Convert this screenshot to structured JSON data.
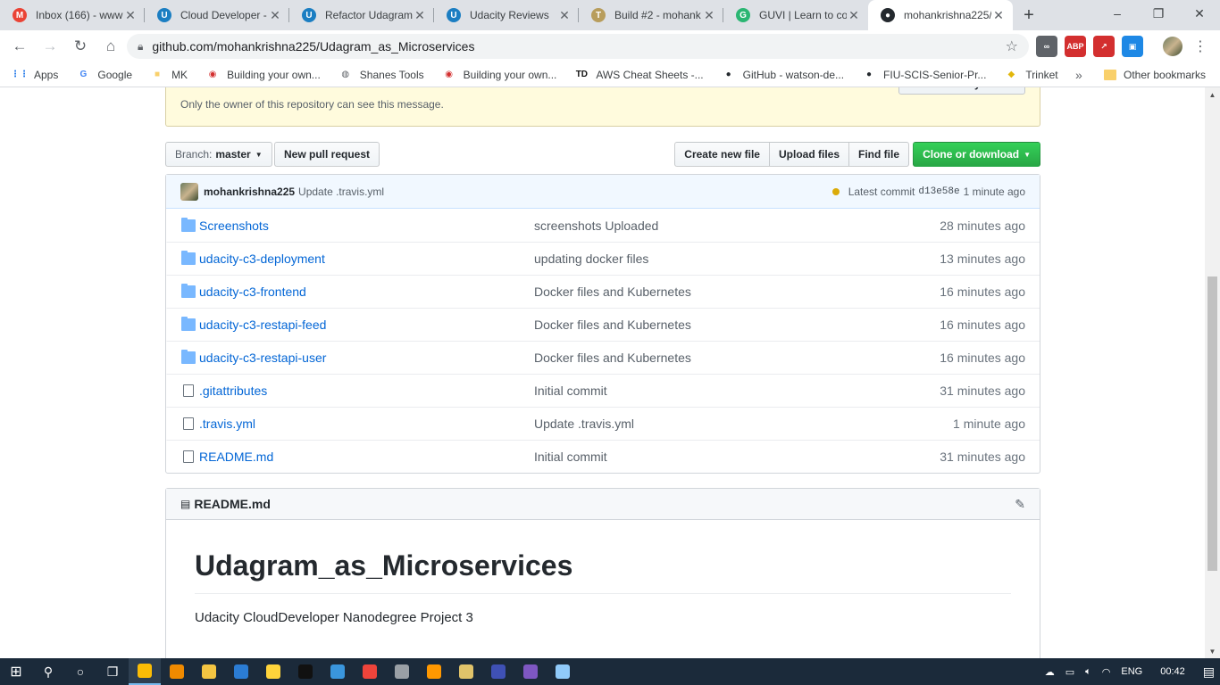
{
  "browser": {
    "tabs": [
      {
        "title": "Inbox (166) - www",
        "icon_color": "#ea4335",
        "icon": "gmail-icon",
        "glyph": "M"
      },
      {
        "title": "Cloud Developer -",
        "icon_color": "#1b7ec2",
        "icon": "udacity-icon",
        "glyph": "U"
      },
      {
        "title": "Refactor Udagram",
        "icon_color": "#1b7ec2",
        "icon": "udacity-icon",
        "glyph": "U"
      },
      {
        "title": "Udacity Reviews",
        "icon_color": "#1b7ec2",
        "icon": "udacity-icon",
        "glyph": "U"
      },
      {
        "title": "Build #2 - mohank",
        "icon_color": "#b89d5c",
        "icon": "travis-icon",
        "glyph": "T"
      },
      {
        "title": "GUVI | Learn to co",
        "icon_color": "#2bb673",
        "icon": "guvi-icon",
        "glyph": "G"
      },
      {
        "title": "mohankrishna225/",
        "icon_color": "#24292e",
        "icon": "github-icon",
        "glyph": "●",
        "active": true
      }
    ],
    "new_tab": "+",
    "window_controls": {
      "minimize": "–",
      "maximize": "❐",
      "close": "✕"
    },
    "address": "github.com/mohankrishna225/Udagram_as_Microservices",
    "extensions": [
      {
        "name": "extension-icon",
        "text": "∞",
        "color": "#5f6368"
      },
      {
        "name": "adblock-icon",
        "text": "ABP",
        "color": "#d32f2f"
      },
      {
        "name": "pdf-icon",
        "text": "↗",
        "color": "#d32f2f"
      },
      {
        "name": "screen-icon",
        "text": "▣",
        "color": "#1e88e5"
      }
    ],
    "bookmarks": [
      {
        "label": "Apps",
        "icon": "apps-icon",
        "glyph": "⋮⋮",
        "color": "#1a73e8"
      },
      {
        "label": "Google",
        "icon": "google-icon",
        "glyph": "G",
        "color": "#4285f4"
      },
      {
        "label": "MK",
        "icon": "folder-icon",
        "glyph": "■",
        "color": "#f9d06b"
      },
      {
        "label": "Building your own...",
        "icon": "site-icon",
        "glyph": "◉",
        "color": "#d32f2f"
      },
      {
        "label": "Shanes Tools",
        "icon": "globe-icon",
        "glyph": "◍",
        "color": "#5f6368"
      },
      {
        "label": "Building your own...",
        "icon": "site-icon",
        "glyph": "◉",
        "color": "#d32f2f"
      },
      {
        "label": "AWS Cheat Sheets -...",
        "icon": "td-icon",
        "glyph": "TD",
        "color": "#111"
      },
      {
        "label": "GitHub - watson-de...",
        "icon": "github-icon",
        "glyph": "●",
        "color": "#24292e"
      },
      {
        "label": "FIU-SCIS-Senior-Pr...",
        "icon": "github-icon",
        "glyph": "●",
        "color": "#24292e"
      },
      {
        "label": "Trinket",
        "icon": "trinket-icon",
        "glyph": "◆",
        "color": "#e2b70b"
      }
    ],
    "bookmarks_more": "»",
    "other_bookmarks": "Other bookmarks"
  },
  "repo": {
    "alert_message": "Only the owner of this repository can see this message.",
    "alert_button": "View security alerts",
    "branch_label": "Branch:",
    "branch_name": "master",
    "new_pr": "New pull request",
    "create_file": "Create new file",
    "upload_files": "Upload files",
    "find_file": "Find file",
    "clone": "Clone or download",
    "commit": {
      "user": "mohankrishna225",
      "message": "Update .travis.yml",
      "latest_label": "Latest commit",
      "sha": "d13e58e",
      "age": "1 minute ago"
    },
    "files": [
      {
        "name": "Screenshots",
        "type": "dir",
        "message": "screenshots Uploaded",
        "age": "28 minutes ago"
      },
      {
        "name": "udacity-c3-deployment",
        "type": "dir",
        "message": "updating docker files",
        "age": "13 minutes ago"
      },
      {
        "name": "udacity-c3-frontend",
        "type": "dir",
        "message": "Docker files and Kubernetes",
        "age": "16 minutes ago"
      },
      {
        "name": "udacity-c3-restapi-feed",
        "type": "dir",
        "message": "Docker files and Kubernetes",
        "age": "16 minutes ago"
      },
      {
        "name": "udacity-c3-restapi-user",
        "type": "dir",
        "message": "Docker files and Kubernetes",
        "age": "16 minutes ago"
      },
      {
        "name": ".gitattributes",
        "type": "file",
        "message": "Initial commit",
        "age": "31 minutes ago"
      },
      {
        "name": ".travis.yml",
        "type": "file",
        "message": "Update .travis.yml",
        "age": "1 minute ago"
      },
      {
        "name": "README.md",
        "type": "file",
        "message": "Initial commit",
        "age": "31 minutes ago"
      }
    ],
    "readme": {
      "header": "README.md",
      "title": "Udagram_as_Microservices",
      "body": "Udacity CloudDeveloper Nanodegree Project 3"
    }
  },
  "taskbar": {
    "apps": [
      {
        "name": "chrome",
        "color": "#fbbc05",
        "active": true
      },
      {
        "name": "vlc",
        "color": "#f08a00"
      },
      {
        "name": "explorer",
        "color": "#f4c542"
      },
      {
        "name": "mail",
        "color": "#2b7cd3"
      },
      {
        "name": "python",
        "color": "#ffd43b"
      },
      {
        "name": "cmd",
        "color": "#111111"
      },
      {
        "name": "control",
        "color": "#3a96dd"
      },
      {
        "name": "anydesk",
        "color": "#ef443b"
      },
      {
        "name": "database",
        "color": "#9aa0a6"
      },
      {
        "name": "sublime",
        "color": "#ff9800"
      },
      {
        "name": "tool",
        "color": "#e0c36a"
      },
      {
        "name": "calendar",
        "color": "#3f51b5"
      },
      {
        "name": "discord",
        "color": "#7e57c2"
      },
      {
        "name": "notepad",
        "color": "#90caf9"
      }
    ],
    "lang": "ENG",
    "time": "00:42"
  }
}
